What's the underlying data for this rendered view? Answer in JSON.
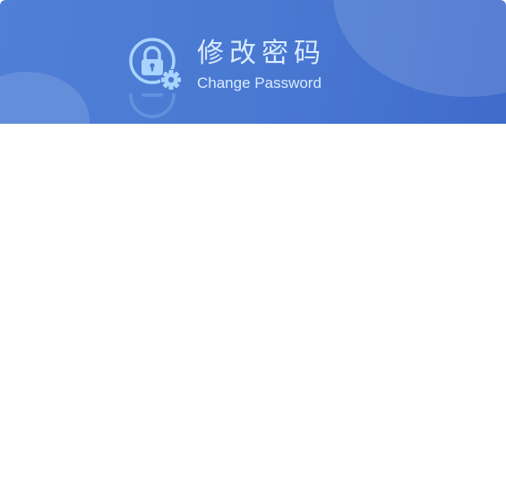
{
  "header": {
    "title_cn": "修改密码",
    "title_en": "Change Password",
    "icon": "lock-gear-icon"
  },
  "colors": {
    "header_gradient_start": "#4f7fd6",
    "header_gradient_end": "#3f6bcc",
    "title_text": "#d9ecff",
    "icon_fill": "#a9d4ff",
    "body_background": "#ffffff"
  }
}
